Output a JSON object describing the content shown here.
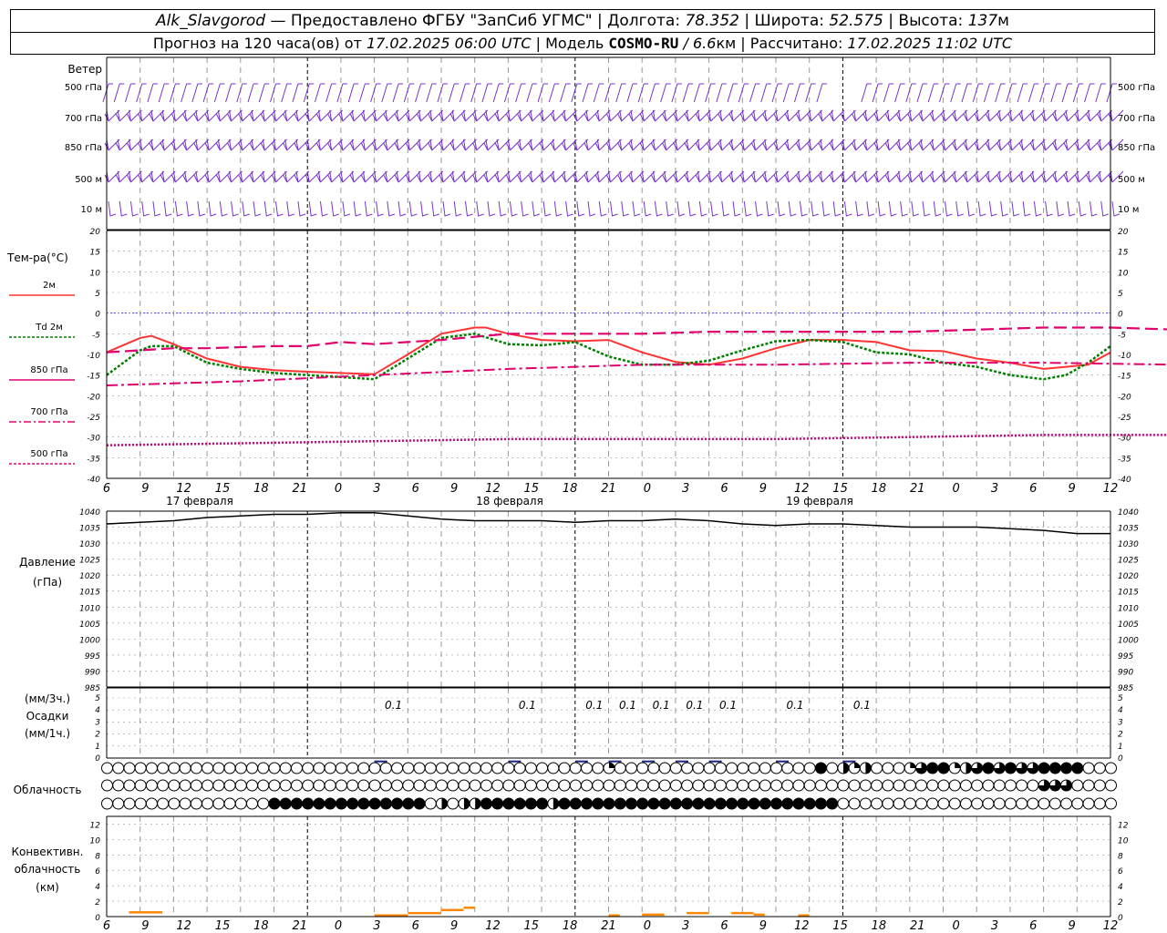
{
  "header": {
    "station": "Alk_Slavgorod",
    "provider": "Предоставлено ФГБУ \"ЗапСиб УГМС\"",
    "lon_label": "Долгота:",
    "lon_value": "78.352",
    "lat_label": "Широта:",
    "lat_value": "52.575",
    "alt_label": "Высота:",
    "alt_value": "137",
    "alt_unit": "м",
    "forecast_prefix": "Прогноз на 120 часа(ов) от",
    "forecast_time": "17.02.2025 06:00 UTC",
    "model_label": "Модель",
    "model_name": "COSMO-RU",
    "model_res": "/ 6.6",
    "model_res_unit": "км",
    "computed_label": "Рассчитано:",
    "computed_time": "17.02.2025 11:02 UTC",
    "sep": "|"
  },
  "colors": {
    "t2m": "#ff3333",
    "td2m": "#008000",
    "t850": "#e0006e",
    "t700": "#e0006e",
    "t500": "#e0006e",
    "zero": "#4444ff",
    "wind": "#7733cc",
    "pressure": "#000000",
    "conv": "#ff8800",
    "grid": "#999999"
  },
  "time_axis": {
    "ticks": [
      "6",
      "9",
      "12",
      "15",
      "18",
      "21",
      "0",
      "3",
      "6",
      "9",
      "12",
      "15",
      "18",
      "21",
      "0",
      "3",
      "6",
      "9",
      "12",
      "15",
      "18",
      "21",
      "0",
      "3",
      "6",
      "9",
      "12"
    ],
    "days": [
      "17 февраля",
      "18 февраля",
      "19 февраля"
    ]
  },
  "wind": {
    "title": "Ветер",
    "levels": [
      "500 гПа",
      "700 гПа",
      "850 гПа",
      "500 м",
      "10 м"
    ]
  },
  "temperature": {
    "title": "Тем-ра(°C)",
    "legend": [
      "2м",
      "Td 2м",
      "850 гПа",
      "700 гПа",
      "500 гПа"
    ],
    "ticks": [
      "20",
      "15",
      "10",
      "5",
      "0",
      "-5",
      "-10",
      "-15",
      "-20",
      "-25",
      "-30",
      "-35",
      "-40"
    ]
  },
  "pressure": {
    "title": "Давление",
    "unit": "(гПа)",
    "ticks": [
      "1040",
      "1035",
      "1030",
      "1025",
      "1020",
      "1015",
      "1010",
      "1005",
      "1000",
      "995",
      "990",
      "985"
    ]
  },
  "precip": {
    "title_unit_3h": "(мм/3ч.)",
    "title": "Осадки",
    "title_unit_1h": "(мм/1ч.)",
    "ticks": [
      "5",
      "4",
      "3",
      "2",
      "1",
      "0"
    ],
    "labels": [
      {
        "h": 24,
        "text": "0.1"
      },
      {
        "h": 36,
        "text": "0.1"
      },
      {
        "h": 42,
        "text": "0.1"
      },
      {
        "h": 45,
        "text": "0.1"
      },
      {
        "h": 48,
        "text": "0.1"
      },
      {
        "h": 51,
        "text": "0.1"
      },
      {
        "h": 54,
        "text": "0.1"
      },
      {
        "h": 60,
        "text": "0.1"
      },
      {
        "h": 66,
        "text": "0.1"
      }
    ]
  },
  "clouds": {
    "title": "Облачность"
  },
  "convective": {
    "title_1": "Конвективн.",
    "title_2": "облачность",
    "title_3": "(км)",
    "ticks": [
      "12",
      "10",
      "8",
      "6",
      "4",
      "2",
      "0"
    ]
  },
  "chart_data": [
    {
      "type": "line",
      "title": "Тем-ра(°C)",
      "x_unit": "hours since 17.02.2025 06:00 UTC",
      "ylim": [
        -40,
        20
      ],
      "series": [
        {
          "name": "2м",
          "x": [
            0,
            3,
            4,
            6,
            9,
            12,
            15,
            18,
            21,
            24,
            27,
            30,
            33,
            34,
            36,
            39,
            42,
            45,
            48,
            51,
            54,
            57,
            60,
            63,
            66,
            69,
            72,
            75,
            78,
            81,
            84,
            86,
            88,
            90
          ],
          "y": [
            -9.5,
            -6,
            -5.5,
            -7.5,
            -11,
            -13,
            -13.8,
            -14.2,
            -14.5,
            -14.8,
            -10,
            -5,
            -3.5,
            -3.5,
            -5,
            -6.5,
            -6.8,
            -6.5,
            -9.5,
            -11.8,
            -12.5,
            -11,
            -8.5,
            -6.5,
            -6.5,
            -7,
            -9,
            -9.2,
            -11,
            -12,
            -13.5,
            -13,
            -12.5,
            -9.5
          ]
        },
        {
          "name": "Td 2м",
          "x": [
            0,
            3,
            4,
            6,
            9,
            12,
            15,
            18,
            21,
            24,
            27,
            30,
            33,
            36,
            39,
            42,
            45,
            48,
            51,
            54,
            57,
            60,
            63,
            66,
            69,
            72,
            75,
            78,
            81,
            84,
            86,
            88,
            90
          ],
          "y": [
            -15,
            -9,
            -8,
            -8,
            -12,
            -13.5,
            -14.5,
            -15,
            -15.5,
            -16,
            -11,
            -6,
            -5,
            -7.5,
            -7.8,
            -7,
            -10.5,
            -12.5,
            -12.5,
            -11.5,
            -9,
            -6.8,
            -6.5,
            -7,
            -9.5,
            -10,
            -12,
            -13,
            -15,
            -16,
            -15,
            -12,
            -8
          ]
        },
        {
          "name": "850 гПа",
          "x": [
            0,
            6,
            9,
            15,
            18,
            21,
            24,
            27,
            30,
            36,
            42,
            48,
            54,
            60,
            66,
            72,
            78,
            84,
            90,
            96,
            102,
            108,
            114,
            120
          ],
          "y": [
            -9.5,
            -8.5,
            -8.5,
            -8,
            -8,
            -7,
            -7.5,
            -7,
            -6.5,
            -5,
            -5,
            -5,
            -4.5,
            -4.5,
            -4.5,
            -4.5,
            -4,
            -3.5,
            -3.5,
            -4,
            -4,
            -4,
            -4,
            -4
          ]
        },
        {
          "name": "700 гПа",
          "x": [
            0,
            12,
            24,
            36,
            48,
            60,
            72,
            84,
            96,
            108,
            120
          ],
          "y": [
            -17.5,
            -16.5,
            -15,
            -13.5,
            -12.5,
            -12.5,
            -12,
            -12,
            -12.5,
            -12.5,
            -12
          ]
        },
        {
          "name": "500 гПа",
          "x": [
            0,
            12,
            24,
            36,
            48,
            60,
            72,
            84,
            96,
            108,
            120
          ],
          "y": [
            -32,
            -31.5,
            -31,
            -30.5,
            -30.5,
            -30.5,
            -30,
            -29.5,
            -29.5,
            -29.5,
            -30
          ]
        }
      ]
    },
    {
      "type": "line",
      "title": "Давление",
      "x_unit": "hours since 17.02.2025 06:00 UTC",
      "ylim": [
        985,
        1040
      ],
      "series": [
        {
          "name": "Давление",
          "x": [
            0,
            3,
            6,
            9,
            12,
            15,
            18,
            21,
            24,
            27,
            30,
            33,
            36,
            39,
            42,
            45,
            48,
            51,
            54,
            57,
            60,
            63,
            66,
            69,
            72,
            75,
            78,
            81,
            84,
            87,
            90
          ],
          "y": [
            1036,
            1036.5,
            1037,
            1038,
            1038.5,
            1039,
            1039,
            1039.5,
            1039.5,
            1038.5,
            1037.5,
            1037,
            1037,
            1037,
            1036.5,
            1037,
            1037,
            1037.5,
            1037,
            1036,
            1035.5,
            1036,
            1036,
            1035.5,
            1035,
            1035,
            1035,
            1034.5,
            1034,
            1033,
            1033
          ]
        }
      ]
    },
    {
      "type": "bar",
      "title": "Осадки",
      "x_unit": "hours since 17.02.2025 06:00 UTC",
      "ylim": [
        0,
        5
      ],
      "x": [
        24,
        36,
        42,
        45,
        48,
        51,
        54,
        60,
        66
      ],
      "values": [
        0.1,
        0.1,
        0.1,
        0.1,
        0.1,
        0.1,
        0.1,
        0.1,
        0.1
      ]
    },
    {
      "type": "bar",
      "title": "Конвективн. облачность (км)",
      "x_unit": "hours since 17.02.2025 06:00 UTC",
      "ylim": [
        0,
        12
      ],
      "segments": [
        {
          "x0": 2,
          "x1": 5,
          "value": 0.7
        },
        {
          "x0": 24,
          "x1": 27,
          "value": 0.3
        },
        {
          "x0": 27,
          "x1": 30,
          "value": 0.6
        },
        {
          "x0": 30,
          "x1": 32,
          "value": 1.0
        },
        {
          "x0": 32,
          "x1": 33,
          "value": 1.3
        },
        {
          "x0": 45,
          "x1": 46,
          "value": 0.3
        },
        {
          "x0": 48,
          "x1": 50,
          "value": 0.4
        },
        {
          "x0": 52,
          "x1": 54,
          "value": 0.6
        },
        {
          "x0": 56,
          "x1": 58,
          "value": 0.6
        },
        {
          "x0": 58,
          "x1": 59,
          "value": 0.4
        },
        {
          "x0": 62,
          "x1": 63,
          "value": 0.3
        }
      ]
    },
    {
      "type": "table",
      "title": "Облачность",
      "note": "cloud cover fraction per 1-hour step (three cloud layers)",
      "rows": [
        {
          "name": "top",
          "x": [
            45,
            64,
            66,
            67,
            68,
            72,
            73,
            74,
            75,
            76,
            77,
            78,
            79,
            80,
            81,
            82,
            83,
            84,
            85,
            86,
            87
          ],
          "values": [
            0.25,
            1,
            0.5,
            0.25,
            0.5,
            0.25,
            0.75,
            1,
            1,
            0.25,
            0.5,
            0.75,
            1,
            0.75,
            1,
            0.75,
            0.75,
            1,
            1,
            1,
            1
          ]
        },
        {
          "name": "middle",
          "x": [
            84,
            85,
            86
          ],
          "values": [
            0.75,
            0.75,
            0.75
          ]
        },
        {
          "name": "bottom",
          "x": [
            15,
            16,
            17,
            18,
            19,
            20,
            21,
            22,
            23,
            24,
            25,
            26,
            27,
            28,
            29,
            30,
            31,
            32,
            33,
            34,
            35,
            36,
            37,
            38,
            39,
            40,
            41,
            42,
            43,
            44,
            45,
            46,
            47,
            48,
            49,
            50,
            51,
            52,
            53,
            54,
            55,
            56,
            57,
            58,
            59,
            60,
            61,
            62,
            63,
            64,
            65
          ],
          "values": [
            1,
            1,
            1,
            1,
            1,
            1,
            1,
            1,
            1,
            1,
            1,
            1,
            1,
            1,
            0,
            0.5,
            0,
            0.5,
            0.5,
            1,
            1,
            1,
            1,
            1,
            1,
            0.5,
            1,
            1,
            1,
            1,
            1,
            1,
            1,
            1,
            1,
            1,
            1,
            1,
            1,
            1,
            1,
            1,
            1,
            1,
            1,
            1,
            1,
            1,
            1,
            1,
            1
          ]
        }
      ]
    }
  ]
}
